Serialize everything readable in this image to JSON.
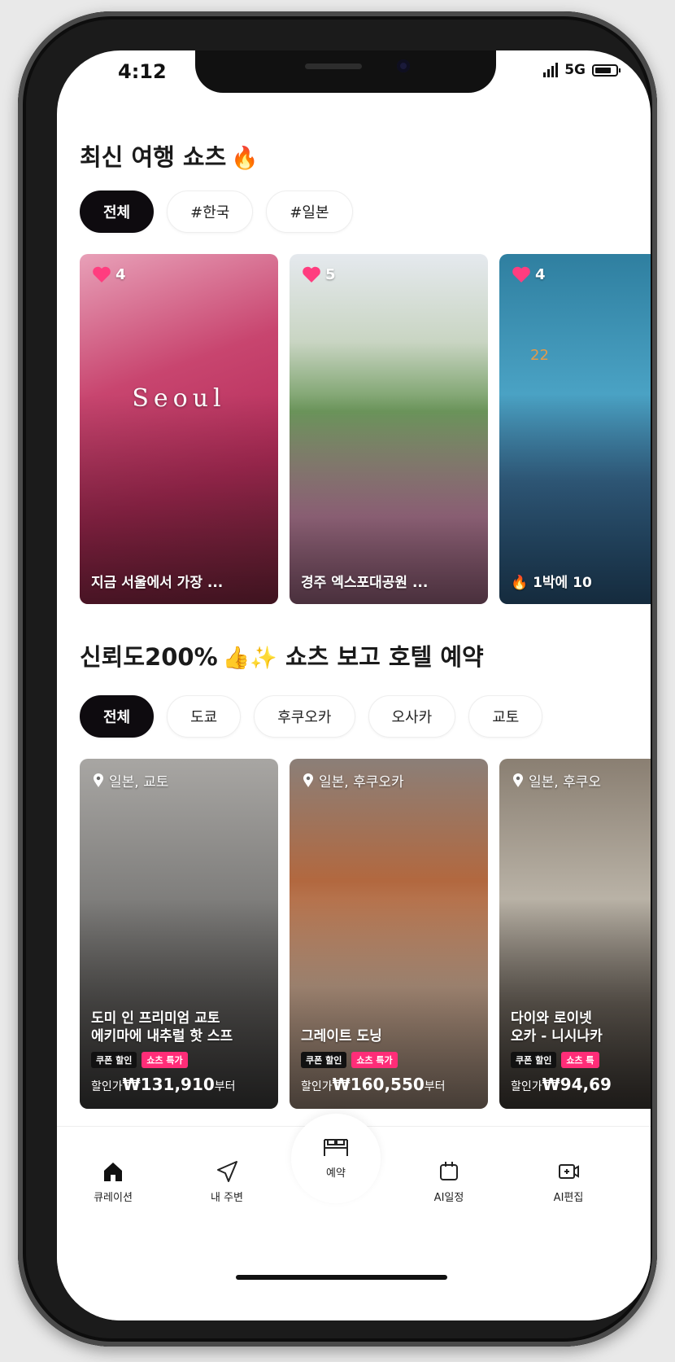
{
  "status_bar": {
    "time": "4:12",
    "network": "5G"
  },
  "section1": {
    "title": "최신 여행 쇼츠",
    "chips": [
      {
        "label": "전체",
        "active": true
      },
      {
        "label": "#한국",
        "active": false
      },
      {
        "label": "#일본",
        "active": false
      }
    ],
    "cards": [
      {
        "likes": "4",
        "overlay": "Seoul",
        "caption": "지금 서울에서 가장 ..."
      },
      {
        "likes": "5",
        "caption": "경주 엑스포대공원 ..."
      },
      {
        "likes": "4",
        "overlay_num": "22",
        "caption": "1박에 10"
      }
    ]
  },
  "section2": {
    "title": "신뢰도200%",
    "title_suffix": "쇼츠 보고 호텔 예약",
    "chips": [
      {
        "label": "전체",
        "active": true
      },
      {
        "label": "도쿄",
        "active": false
      },
      {
        "label": "후쿠오카",
        "active": false
      },
      {
        "label": "오사카",
        "active": false
      },
      {
        "label": "교토",
        "active": false
      }
    ],
    "cards": [
      {
        "location": "일본, 교토",
        "name1": "도미 인 프리미엄 교토",
        "name2": "에키마에 내추럴 핫 스프",
        "badge1": "쿠폰 할인",
        "badge2": "쇼츠 특가",
        "price_prefix": "할인가",
        "price": "₩131,910",
        "price_suffix": "부터"
      },
      {
        "location": "일본, 후쿠오카",
        "name1": "그레이트 도닝",
        "name2": "",
        "badge1": "쿠폰 할인",
        "badge2": "쇼츠 특가",
        "price_prefix": "할인가",
        "price": "₩160,550",
        "price_suffix": "부터"
      },
      {
        "location": "일본, 후쿠오",
        "name1": "다이와 로이넷",
        "name2": "오카 - 니시나카",
        "badge1": "쿠폰 할인",
        "badge2": "쇼츠 특",
        "price_prefix": "할인가",
        "price": "₩94,69",
        "price_suffix": ""
      }
    ]
  },
  "tabbar": {
    "tabs": [
      {
        "label": "큐레이션",
        "icon": "home-icon"
      },
      {
        "label": "내 주변",
        "icon": "navigation-icon"
      },
      {
        "label": "예약",
        "icon": "bed-icon"
      },
      {
        "label": "AI일정",
        "icon": "calendar-ai-icon"
      },
      {
        "label": "AI편집",
        "icon": "video-edit-icon"
      }
    ]
  },
  "colors": {
    "accent_pink": "#ff2d78",
    "chip_active": "#0e0b0f"
  }
}
